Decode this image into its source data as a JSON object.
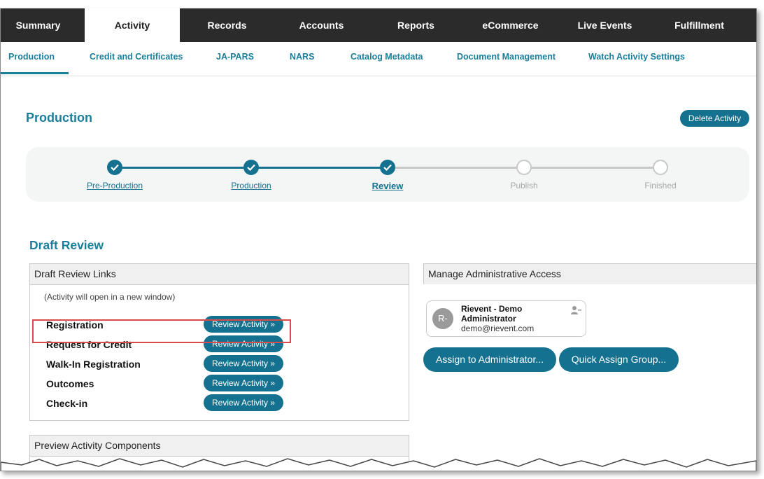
{
  "top_nav": [
    {
      "label": "Summary"
    },
    {
      "label": "Activity"
    },
    {
      "label": "Records"
    },
    {
      "label": "Accounts"
    },
    {
      "label": "Reports"
    },
    {
      "label": "eCommerce"
    },
    {
      "label": "Live Events"
    },
    {
      "label": "Fulfillment"
    }
  ],
  "sub_nav": [
    {
      "label": "Production"
    },
    {
      "label": "Credit and Certificates"
    },
    {
      "label": "JA-PARS"
    },
    {
      "label": "NARS"
    },
    {
      "label": "Catalog Metadata"
    },
    {
      "label": "Document Management"
    },
    {
      "label": "Watch Activity Settings"
    }
  ],
  "page_title": "Production",
  "delete_button": "Delete Activity",
  "steps": [
    {
      "label": "Pre-Production",
      "status": "done"
    },
    {
      "label": "Production",
      "status": "done"
    },
    {
      "label": "Review",
      "status": "current"
    },
    {
      "label": "Publish",
      "status": "todo"
    },
    {
      "label": "Finished",
      "status": "todo"
    }
  ],
  "draft_review": {
    "title": "Draft Review",
    "links_panel": {
      "title": "Draft Review Links",
      "note": "(Activity will open in a new window)",
      "button_label": "Review Activity »",
      "rows": [
        {
          "label": "Registration"
        },
        {
          "label": "Request for Credit"
        },
        {
          "label": "Walk-In Registration"
        },
        {
          "label": "Outcomes"
        },
        {
          "label": "Check-in"
        }
      ]
    },
    "preview_panel": {
      "title": "Preview Activity Components"
    }
  },
  "admin_access": {
    "title": "Manage Administrative Access",
    "admin": {
      "initials": "R-",
      "name": "Rievent - Demo Administrator",
      "email": "demo@rievent.com"
    },
    "assign_button": "Assign to Administrator...",
    "quick_assign_button": "Quick Assign Group..."
  },
  "colors": {
    "accent": "#1a7f9c",
    "button": "#14718f",
    "nav_bg": "#2b2b2b",
    "highlight": "#d94c4c"
  }
}
